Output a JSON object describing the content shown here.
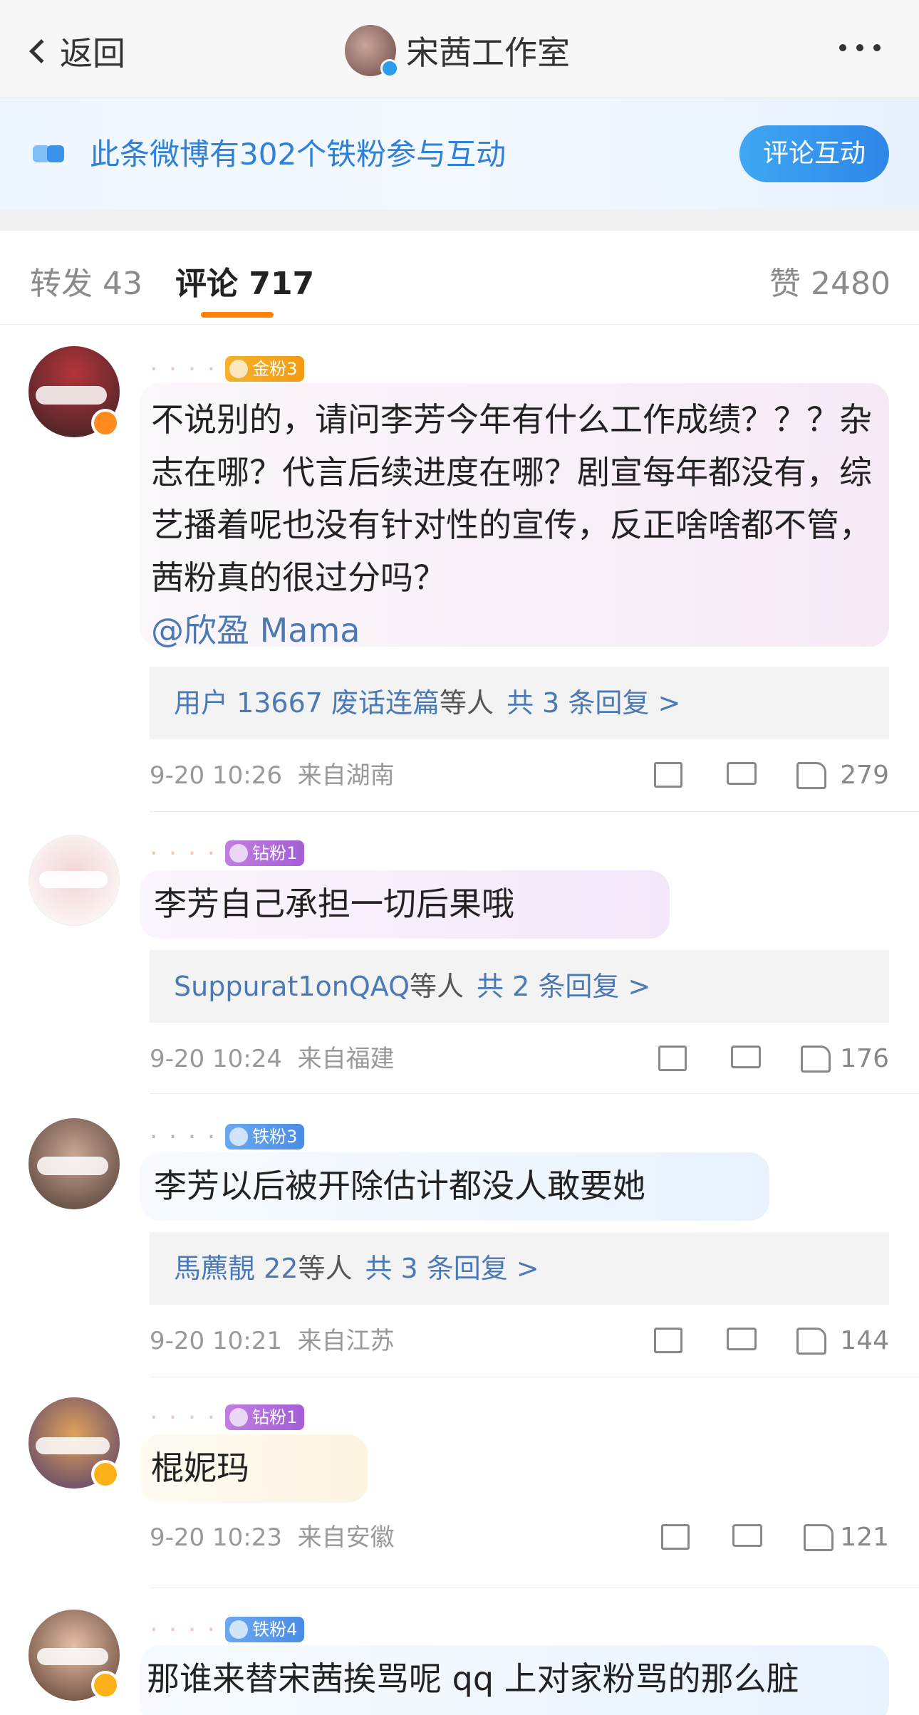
{
  "header": {
    "back_label": "返回",
    "title": "宋茜工作室"
  },
  "banner": {
    "text": "此条微博有302个铁粉参与互动",
    "button": "评论互动"
  },
  "tabs": {
    "repost_label": "转发",
    "repost_count": "43",
    "comment_label": "评论",
    "comment_count": "717",
    "like_label": "赞",
    "like_count": "2480"
  },
  "colors": {
    "accent": "#ff8200",
    "link": "#4a79b5",
    "banner_text": "#2f80d8"
  },
  "comments": [
    {
      "badge": "金粉3",
      "text": "不说别的，请问李芳今年有什么工作成绩？？？杂志在哪？代言后续进度在哪？剧宣每年都没有，综艺播着呢也没有针对性的宣传，反正啥啥都不管，茜粉真的很过分吗？",
      "mention": "@欣盈 Mama",
      "reply_user": "用户 13667 废话连篇",
      "reply_more": "等人",
      "reply_count": "共 3 条回复 >",
      "time": "9-20 10:26",
      "location": "来自湖南",
      "likes": "279"
    },
    {
      "badge": "钻粉1",
      "text": "李芳自己承担一切后果哦",
      "reply_user": "Suppurat1onQAQ",
      "reply_more": "等人",
      "reply_count": "共 2 条回复 >",
      "time": "9-20 10:24",
      "location": "来自福建",
      "likes": "176"
    },
    {
      "badge": "铁粉3",
      "text": "李芳以后被开除估计都没人敢要她",
      "reply_user": "馬藨靚 22",
      "reply_more": "等人",
      "reply_count": "共 3 条回复 >",
      "time": "9-20 10:21",
      "location": "来自江苏",
      "likes": "144"
    },
    {
      "badge": "钻粉1",
      "text": "棍妮玛",
      "time": "9-20 10:23",
      "location": "来自安徽",
      "likes": "121"
    },
    {
      "badge": "铁粉4",
      "text": "那谁来替宋茜挨骂呢 qq 上对家粉骂的那么脏"
    }
  ]
}
